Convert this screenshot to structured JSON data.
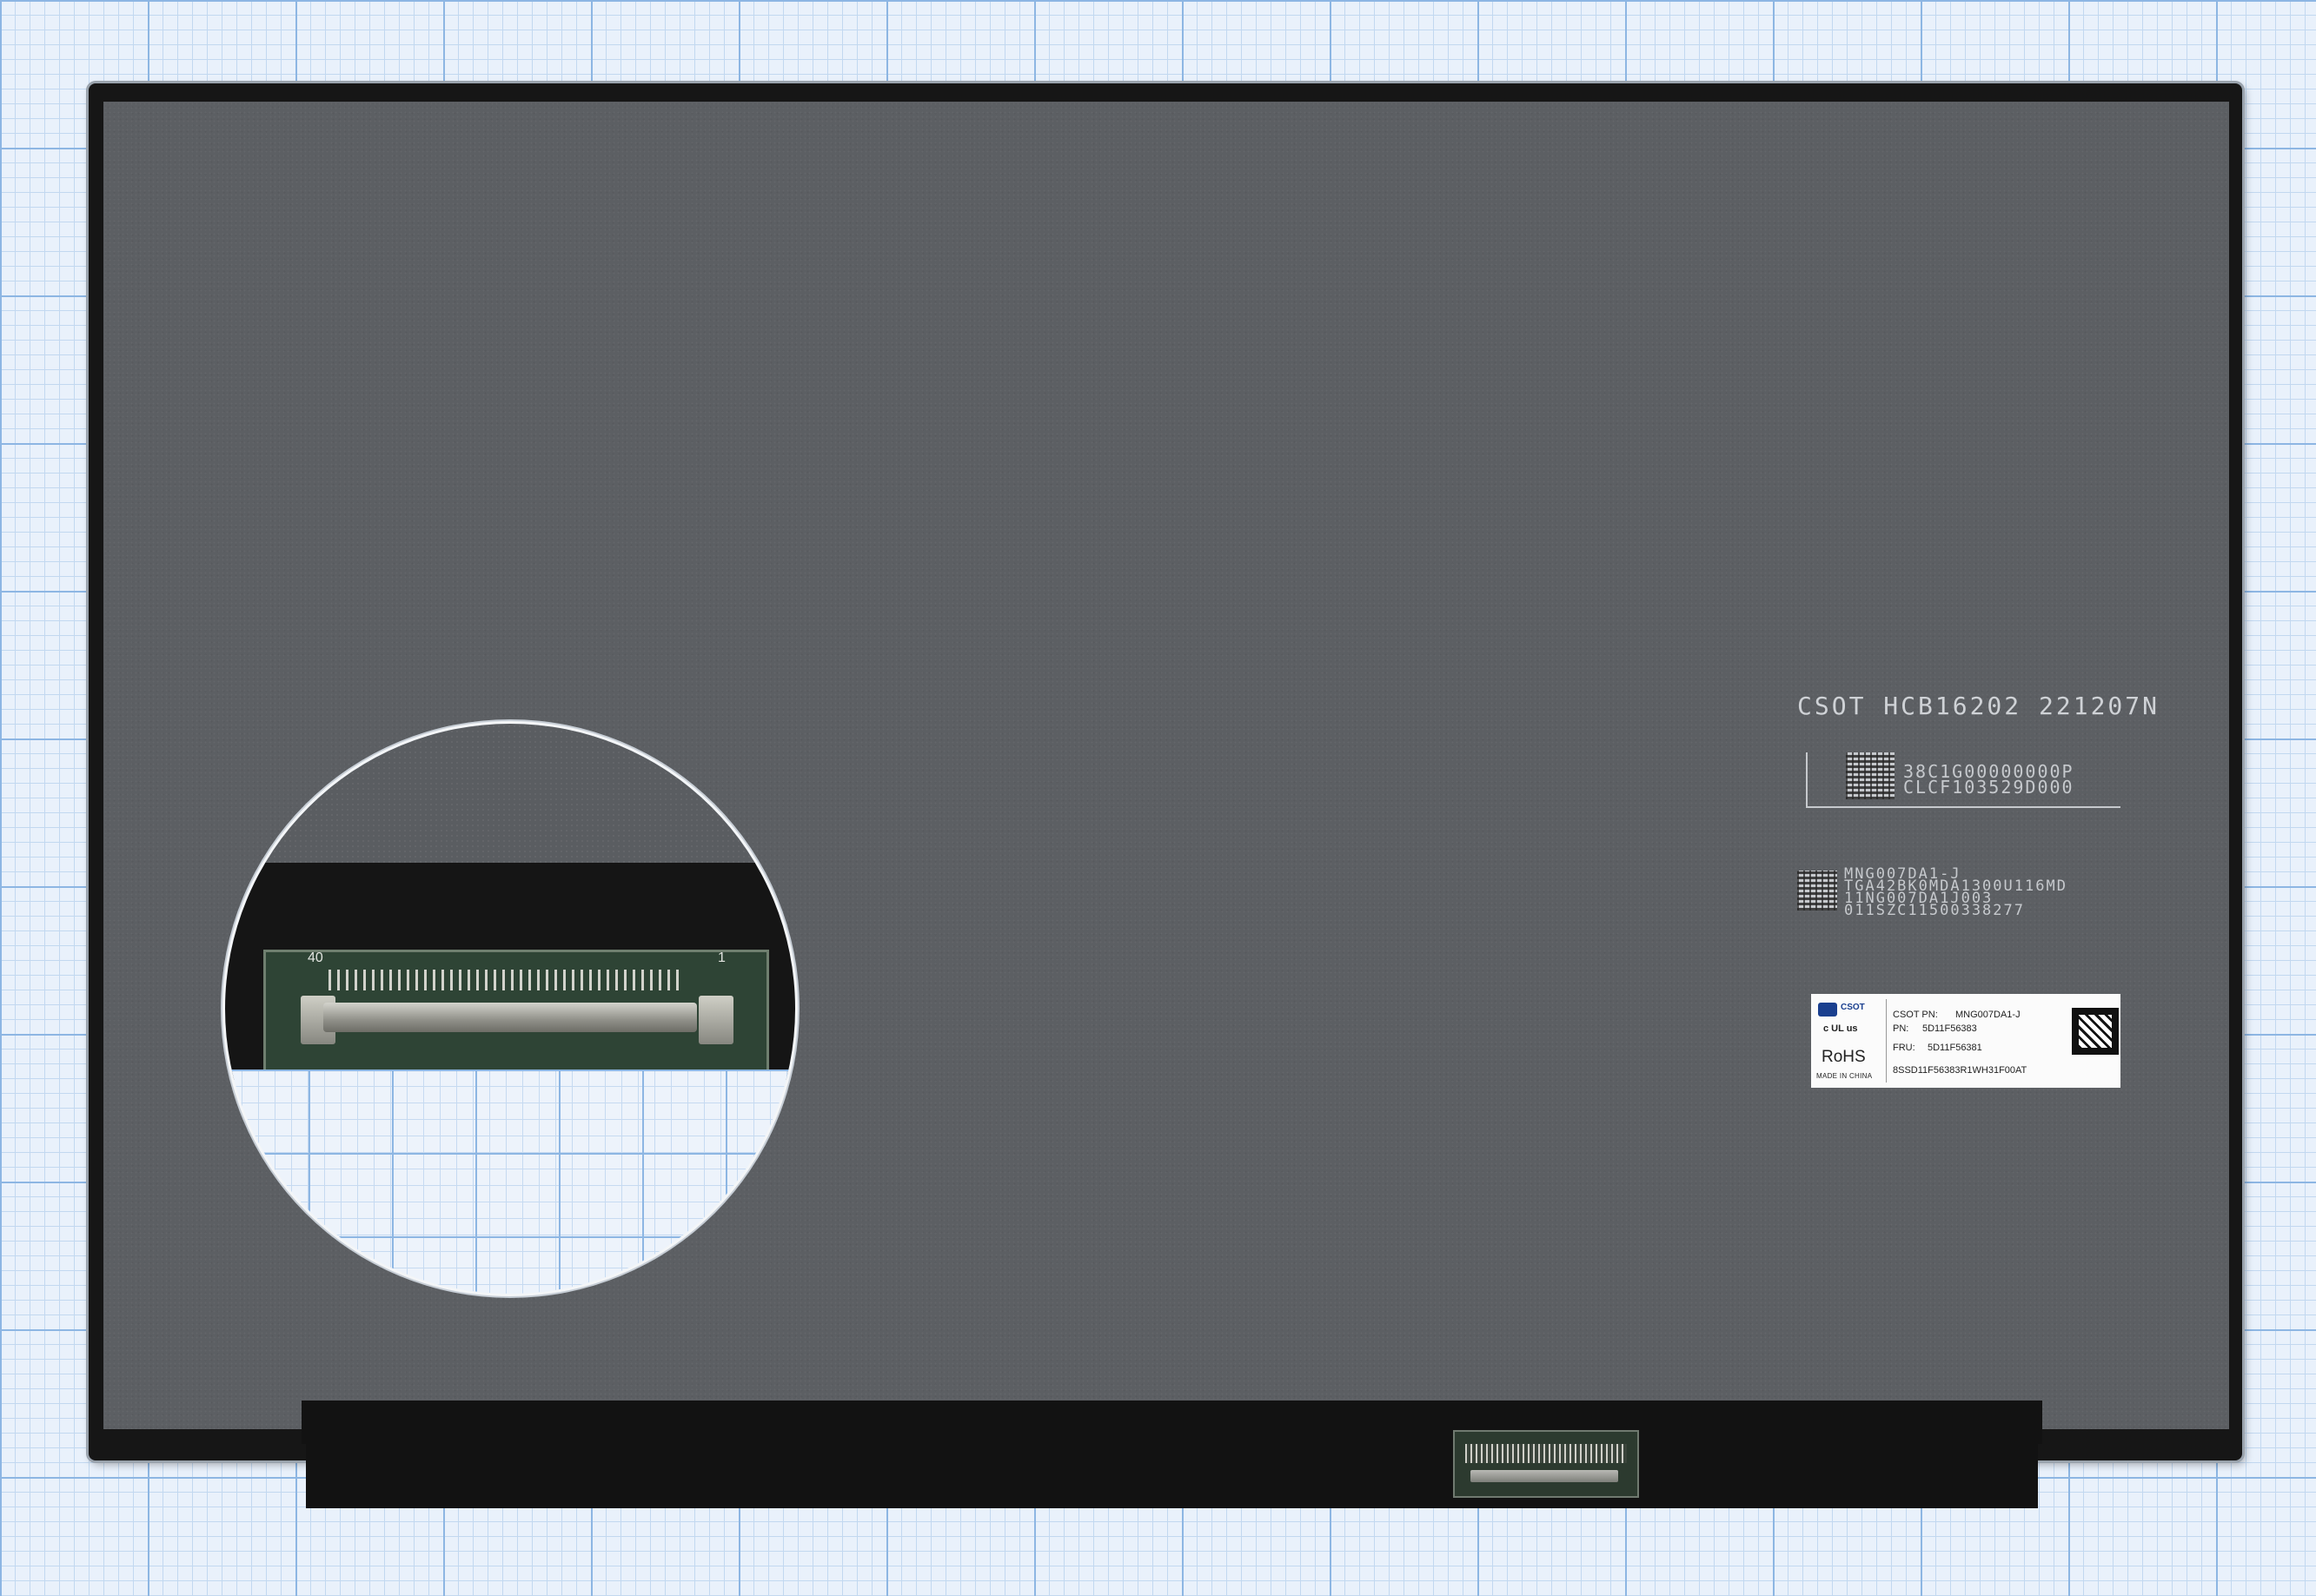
{
  "panel_markings": {
    "model_line": "CSOT  HCB16202  221207N",
    "barcode1_line1": "38C1G00000000P",
    "barcode1_line2": "CLCF103529D000",
    "barcode2_line1": "MNG007DA1-J",
    "barcode2_line2": "TGA42BK0MDA1300U116MD",
    "barcode2_line3": "11NG007DA1J003",
    "barcode2_line4": "011SZC11500338277"
  },
  "sticker": {
    "logo": "CSOT",
    "ul_mark": "c UL us",
    "rohs": "RoHS",
    "made_in": "MADE IN CHINA",
    "csot_pn_label": "CSOT PN:",
    "csot_pn_value": "MNG007DA1-J",
    "pn_label": "PN:",
    "pn_value": "5D11F56383",
    "fru_label": "FRU:",
    "fru_value": "5D11F56381",
    "serial": "8SSD11F56383R1WH31F00AT"
  },
  "connector_zoom": {
    "pin_start": "40",
    "pin_end": "1"
  }
}
